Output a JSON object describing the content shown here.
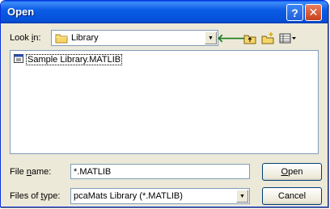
{
  "window": {
    "title": "Open"
  },
  "lookin": {
    "label_pre": "Look ",
    "label_key": "i",
    "label_post": "n:",
    "value": "Library"
  },
  "files": [
    {
      "name": "Sample Library.MATLIB"
    }
  ],
  "filename": {
    "label_pre": "File ",
    "label_key": "n",
    "label_post": "ame:",
    "value": "*.MATLIB"
  },
  "filetype": {
    "label_pre": "Files of ",
    "label_key": "t",
    "label_post": "ype:",
    "value": "pcaMats Library (*.MATLIB)"
  },
  "buttons": {
    "open_key": "O",
    "open_rest": "pen",
    "cancel": "Cancel"
  },
  "icons": {
    "help": "help-icon",
    "close": "close-icon",
    "back": "back-arrow-icon",
    "up": "up-folder-icon",
    "new_folder": "new-folder-icon",
    "views": "views-menu-icon"
  }
}
